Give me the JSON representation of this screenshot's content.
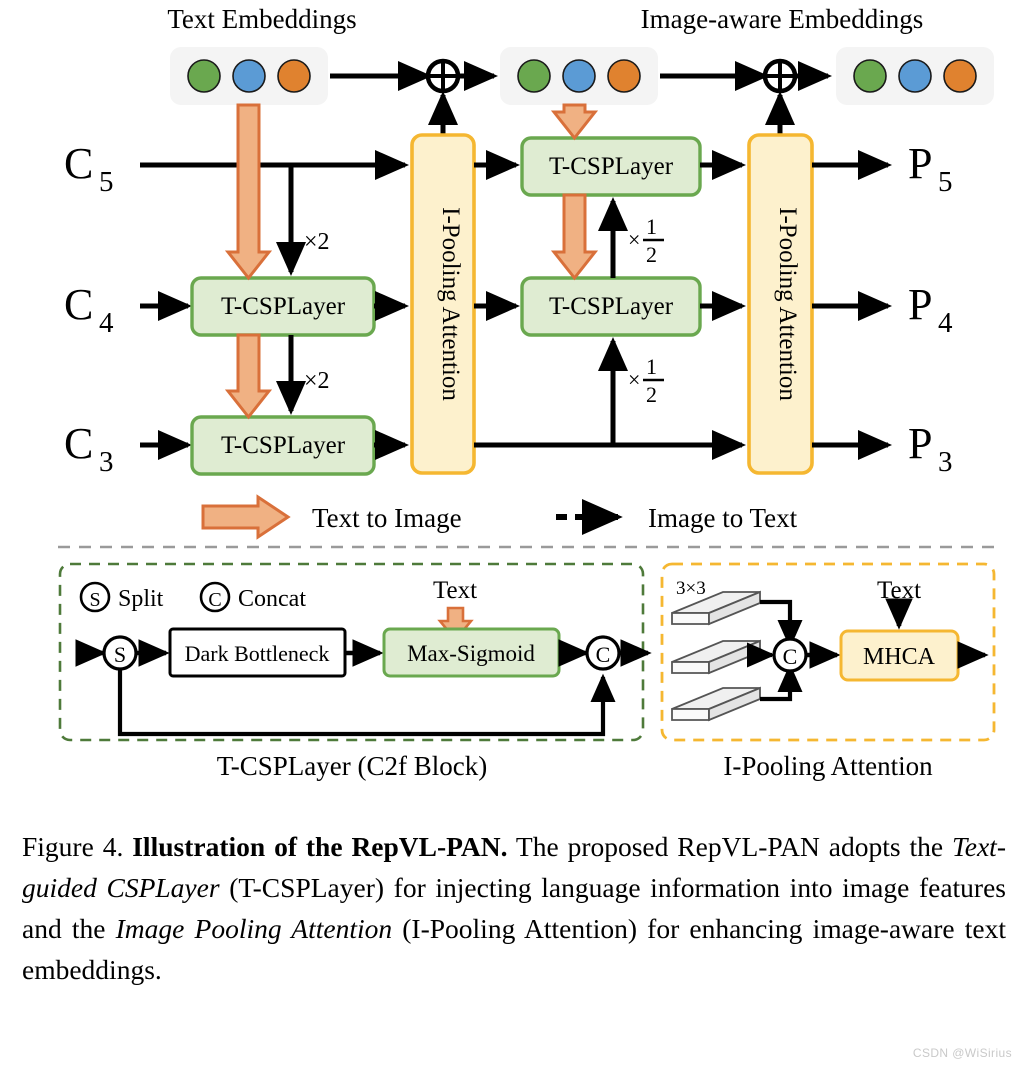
{
  "figure": {
    "top_labels": {
      "text_embeddings": "Text Embeddings",
      "image_aware_embeddings": "Image-aware Embeddings"
    },
    "inputs": [
      "C",
      "C",
      "C"
    ],
    "input_labels": [
      {
        "base": "C",
        "sub": "5"
      },
      {
        "base": "C",
        "sub": "4"
      },
      {
        "base": "C",
        "sub": "3"
      }
    ],
    "output_labels": [
      {
        "base": "P",
        "sub": "5"
      },
      {
        "base": "P",
        "sub": "4"
      },
      {
        "base": "P",
        "sub": "3"
      }
    ],
    "blocks": {
      "tcsp": "T-CSPLayer",
      "ipool": "I-Pooling Attention",
      "mhca": "MHCA",
      "dark_bottleneck": "Dark Bottleneck",
      "max_sigmoid": "Max-Sigmoid"
    },
    "scale_labels": {
      "upsample": "×2",
      "downsample_prefix": "×",
      "downsample_num": "1",
      "downsample_den": "2"
    },
    "legend": {
      "text_to_image": "Text to Image",
      "image_to_text": "Image to Text"
    },
    "embedding_colors": [
      "#6aa84f",
      "#5b9bd5",
      "#e0822f"
    ],
    "panels": {
      "left": {
        "caption": "T-CSPLayer (C2f Block)",
        "key_split_symbol": "S",
        "key_split_label": "Split",
        "key_concat_symbol": "C",
        "key_concat_label": "Concat",
        "text_arrow_label": "Text",
        "split_node": "S",
        "concat_node": "C"
      },
      "right": {
        "caption": "I-Pooling Attention",
        "kernel_label": "3×3",
        "text_arrow_label": "Text",
        "concat_node": "C"
      }
    },
    "colors": {
      "green_fill": "#dfecd2",
      "green_stroke": "#6aa84f",
      "yellow_fill": "#fdf1cd",
      "yellow_stroke": "#f5b731",
      "orange_arrow_fill": "#f0b183",
      "orange_arrow_stroke": "#d9703a",
      "embed_box_fill": "#f4f4f4",
      "dash_divider": "#9a9a9a"
    }
  },
  "caption": {
    "prefix": "Figure 4.",
    "bold": "Illustration of the RepVL-PAN.",
    "part1": " The proposed RepVL-PAN adopts the ",
    "italic1": "Text-guided CSPLayer",
    "part2": " (T-CSPLayer) for injecting language information into image features and the ",
    "italic2": "Image Pooling Attention",
    "part3": " (I-Pooling Attention) for enhancing image-aware text embeddings."
  },
  "watermark": {
    "text": "CSDN @WiSirius"
  }
}
